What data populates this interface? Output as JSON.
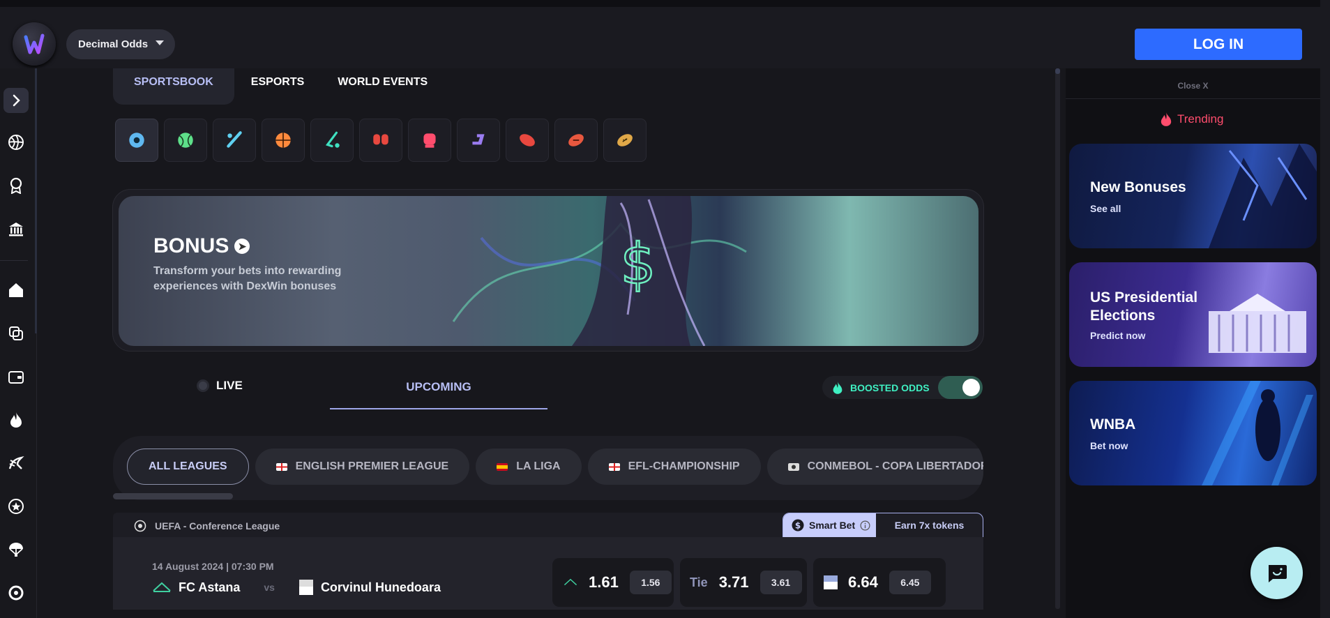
{
  "header": {
    "odds_format": "Decimal Odds",
    "login_label": "LOG IN"
  },
  "tabs": [
    {
      "label": "SPORTSBOOK"
    },
    {
      "label": "ESPORTS"
    },
    {
      "label": "WORLD EVENTS"
    }
  ],
  "sports": [
    {
      "name": "soccer-icon",
      "color": "#5fb8f0"
    },
    {
      "name": "tennis-icon",
      "color": "#5ee08a"
    },
    {
      "name": "cricket-icon",
      "color": "#5fd0f0"
    },
    {
      "name": "basketball-icon",
      "color": "#ff8a3d"
    },
    {
      "name": "hockey-icon",
      "color": "#3fe0c0"
    },
    {
      "name": "boxing-gloves-icon",
      "color": "#e8483f"
    },
    {
      "name": "mma-glove-icon",
      "color": "#ff4d6d"
    },
    {
      "name": "esports-icon",
      "color": "#9a7cf0"
    },
    {
      "name": "rugby-icon",
      "color": "#e8483f"
    },
    {
      "name": "football-icon",
      "color": "#e8583f"
    },
    {
      "name": "american-football-icon",
      "color": "#e0a848"
    }
  ],
  "banner": {
    "title": "BONUS",
    "subtitle": "Transform your bets into rewarding experiences with DexWin bonuses"
  },
  "modes": {
    "live": "LIVE",
    "upcoming": "UPCOMING",
    "boosted": "BOOSTED ODDS"
  },
  "leagues": [
    {
      "label": "ALL LEAGUES",
      "flag": ""
    },
    {
      "label": "ENGLISH PREMIER LEAGUE",
      "flag": "england"
    },
    {
      "label": "LA LIGA",
      "flag": "spain"
    },
    {
      "label": "EFL-CHAMPIONSHIP",
      "flag": "england"
    },
    {
      "label": "CONMEBOL - COPA LIBERTADORES",
      "flag": "conmebol"
    }
  ],
  "match": {
    "competition": "UEFA - Conference League",
    "smart_bet": "Smart Bet",
    "earn": "Earn 7x tokens",
    "date": "14 August 2024 | 07:30 PM",
    "home": "FC Astana",
    "vs": "vs",
    "away": "Corvinul Hunedoara",
    "odds": [
      {
        "label": "",
        "value": "1.61",
        "prev": "1.56"
      },
      {
        "label": "Tie",
        "value": "3.71",
        "prev": "3.61"
      },
      {
        "label": "",
        "value": "6.64",
        "prev": "6.45"
      }
    ]
  },
  "right_panel": {
    "close": "Close X",
    "trending": "Trending",
    "promos": [
      {
        "title": "New Bonuses",
        "link": "See all"
      },
      {
        "title": "US Presidential Elections",
        "link": "Predict now"
      },
      {
        "title": "WNBA",
        "link": "Bet now"
      }
    ]
  }
}
